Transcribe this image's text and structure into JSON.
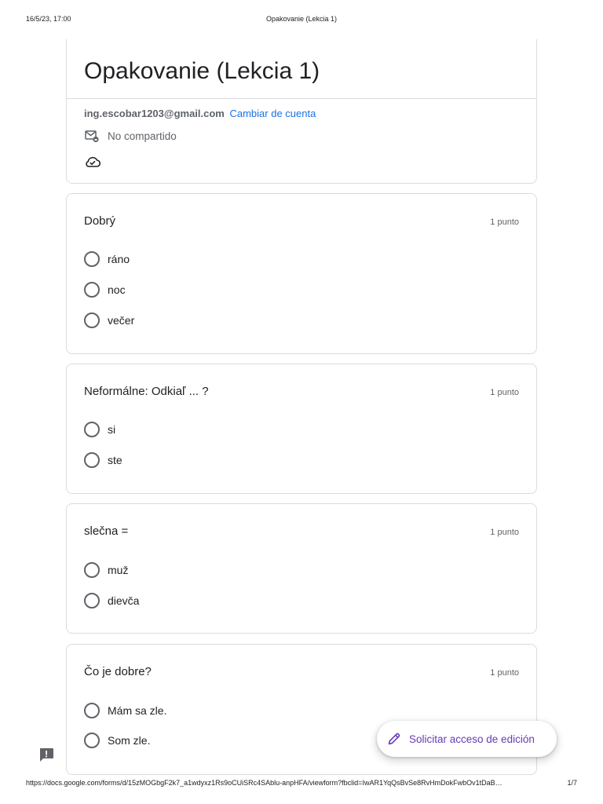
{
  "print": {
    "datetime": "16/5/23, 17:00",
    "doc_title": "Opakovanie (Lekcia 1)",
    "url": "https://docs.google.com/forms/d/15zMOGbgF2k7_a1wdyxz1Rs9oCUiSRc4SAblu-anpHFA/viewform?fbclid=IwAR1YqQsBvSe8RvHmDokFwbOv1tDaB…",
    "page": "1/7"
  },
  "form": {
    "title": "Opakovanie (Lekcia 1)",
    "account_email": "ing.escobar1203@gmail.com",
    "switch_account": "Cambiar de cuenta",
    "shared_status": "No compartido"
  },
  "questions": [
    {
      "title": "Dobrý",
      "points": "1 punto",
      "options": [
        "ráno",
        "noc",
        "večer"
      ]
    },
    {
      "title": "Neformálne: Odkiaľ ... ?",
      "points": "1 punto",
      "options": [
        "si",
        "ste"
      ]
    },
    {
      "title": "slečna =",
      "points": "1 punto",
      "options": [
        "muž",
        "dievča"
      ]
    },
    {
      "title": "Čo je dobre?",
      "points": "1 punto",
      "options": [
        "Mám sa zle.",
        "Som zle."
      ]
    }
  ],
  "fab": {
    "label": "Solicitar acceso de edición"
  },
  "icons": {
    "shared": "mail-lock-icon",
    "cloud": "cloud-check-icon",
    "pen": "pencil-icon",
    "report": "report-feedback-icon"
  },
  "colors": {
    "accent": "#673ab7",
    "link": "#1a73e8",
    "border": "#dadce0"
  }
}
